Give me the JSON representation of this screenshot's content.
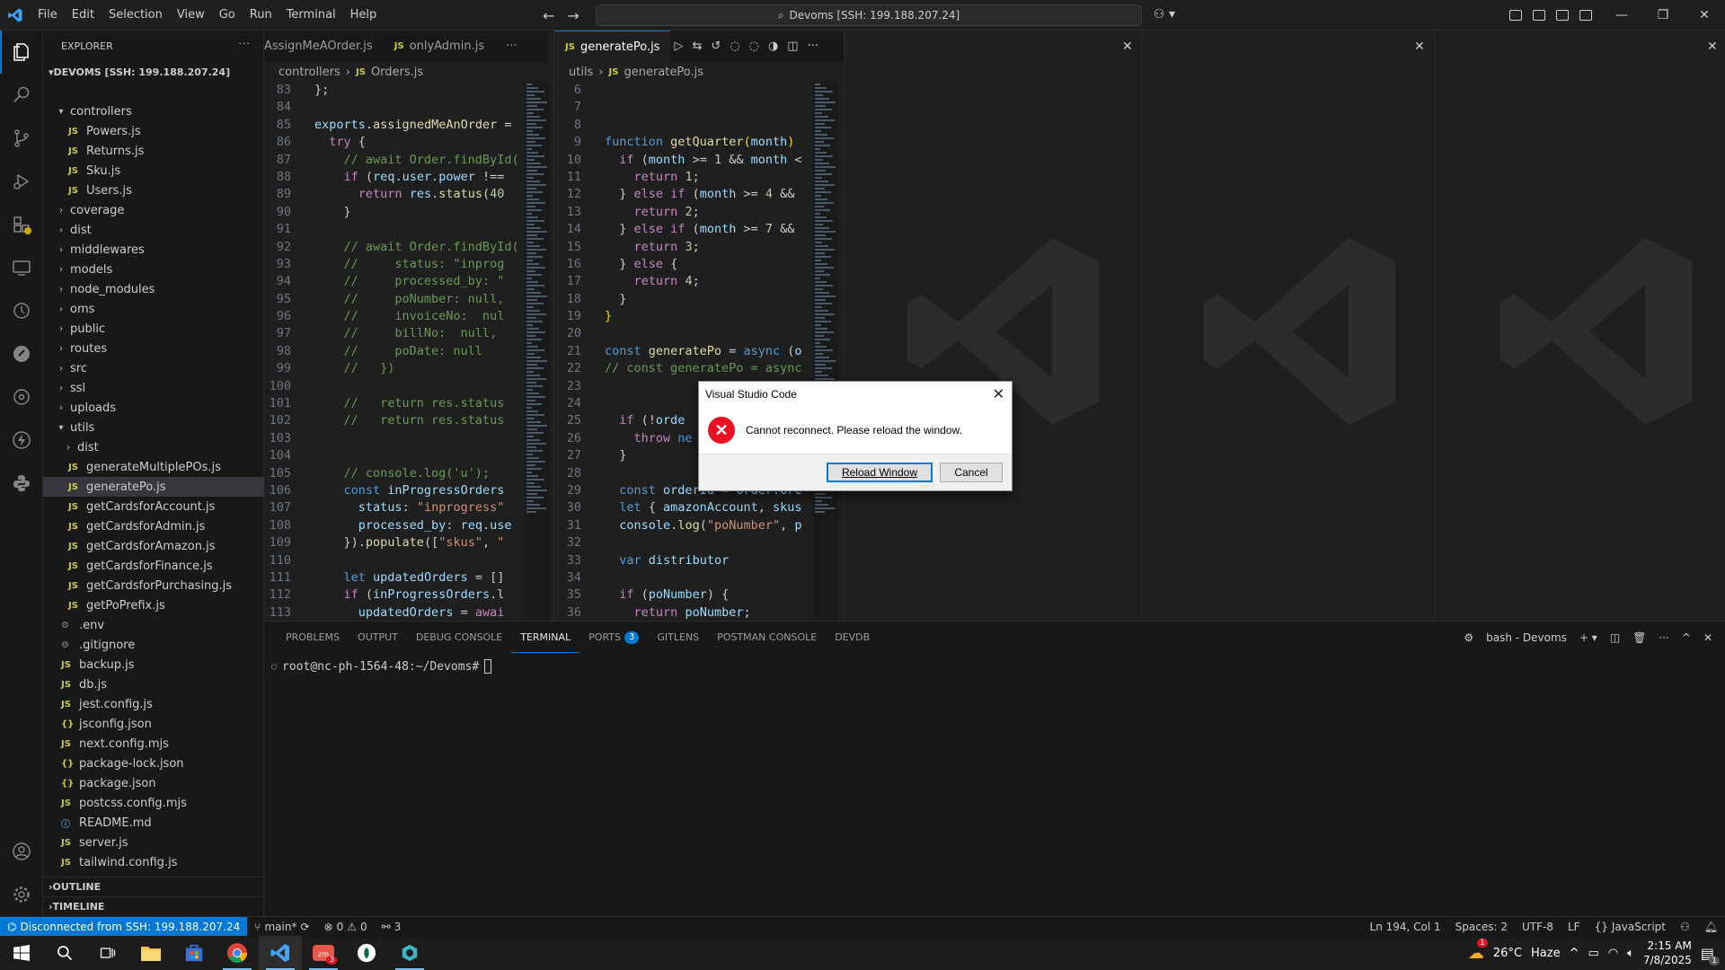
{
  "titlebar": {
    "menu": [
      "File",
      "Edit",
      "Selection",
      "View",
      "Go",
      "Run",
      "Terminal",
      "Help"
    ],
    "search": "Devoms [SSH: 199.188.207.24]"
  },
  "explorer": {
    "header": "EXPLORER",
    "root": "DEVOMS [SSH: 199.188.207.24]",
    "tree": [
      {
        "label": "controllers",
        "type": "folder-open",
        "depth": 1
      },
      {
        "label": "Powers.js",
        "type": "js",
        "depth": 2
      },
      {
        "label": "Returns.js",
        "type": "js",
        "depth": 2
      },
      {
        "label": "Sku.js",
        "type": "js",
        "depth": 2
      },
      {
        "label": "Users.js",
        "type": "js",
        "depth": 2
      },
      {
        "label": "coverage",
        "type": "folder",
        "depth": 1
      },
      {
        "label": "dist",
        "type": "folder",
        "depth": 1
      },
      {
        "label": "middlewares",
        "type": "folder",
        "depth": 1
      },
      {
        "label": "models",
        "type": "folder",
        "depth": 1
      },
      {
        "label": "node_modules",
        "type": "folder",
        "depth": 1
      },
      {
        "label": "oms",
        "type": "folder",
        "depth": 1
      },
      {
        "label": "public",
        "type": "folder",
        "depth": 1
      },
      {
        "label": "routes",
        "type": "folder",
        "depth": 1
      },
      {
        "label": "src",
        "type": "folder",
        "depth": 1
      },
      {
        "label": "ssl",
        "type": "folder",
        "depth": 1
      },
      {
        "label": "uploads",
        "type": "folder",
        "depth": 1
      },
      {
        "label": "utils",
        "type": "folder-open",
        "depth": 1
      },
      {
        "label": "dist",
        "type": "folder",
        "depth": 2
      },
      {
        "label": "generateMultiplePOs.js",
        "type": "js",
        "depth": 2
      },
      {
        "label": "generatePo.js",
        "type": "js",
        "depth": 2,
        "selected": true
      },
      {
        "label": "getCardsforAccount.js",
        "type": "js",
        "depth": 2
      },
      {
        "label": "getCardsforAdmin.js",
        "type": "js",
        "depth": 2
      },
      {
        "label": "getCardsforAmazon.js",
        "type": "js",
        "depth": 2
      },
      {
        "label": "getCardsforFinance.js",
        "type": "js",
        "depth": 2
      },
      {
        "label": "getCardsforPurchasing.js",
        "type": "js",
        "depth": 2
      },
      {
        "label": "getPoPrefix.js",
        "type": "js",
        "depth": 2
      },
      {
        "label": ".env",
        "type": "env",
        "depth": 1
      },
      {
        "label": ".gitignore",
        "type": "env",
        "depth": 1
      },
      {
        "label": "backup.js",
        "type": "js",
        "depth": 1
      },
      {
        "label": "db.js",
        "type": "js",
        "depth": 1
      },
      {
        "label": "jest.config.js",
        "type": "js",
        "depth": 1
      },
      {
        "label": "jsconfig.json",
        "type": "json",
        "depth": 1
      },
      {
        "label": "next.config.mjs",
        "type": "js",
        "depth": 1
      },
      {
        "label": "package-lock.json",
        "type": "json",
        "depth": 1
      },
      {
        "label": "package.json",
        "type": "json",
        "depth": 1
      },
      {
        "label": "postcss.config.mjs",
        "type": "js",
        "depth": 1
      },
      {
        "label": "README.md",
        "type": "info",
        "depth": 1
      },
      {
        "label": "server.js",
        "type": "js",
        "depth": 1
      },
      {
        "label": "tailwind.config.js",
        "type": "js",
        "depth": 1
      }
    ],
    "outline": "OUTLINE",
    "timeline": "TIMELINE"
  },
  "editor1": {
    "tabs": [
      {
        "label": "AssignMeAOrder.js",
        "active": false
      },
      {
        "label": "onlyAdmin.js",
        "active": false
      }
    ],
    "breadcrumb": [
      "controllers",
      "Orders.js"
    ],
    "lines": [
      {
        "n": "83",
        "html": "<span class='src'>};</span>"
      },
      {
        "n": "84",
        "html": ""
      },
      {
        "n": "85",
        "html": "<span class='v'>exports</span><span class='src'>.</span><span class='f'>assignedMeAnOrder</span><span class='src'> = </span>"
      },
      {
        "n": "86",
        "html": "<span class='src'>  </span><span class='kc'>try</span><span class='src'> {</span>"
      },
      {
        "n": "87",
        "html": "<span class='c'>    // await Order.findById(</span>"
      },
      {
        "n": "88",
        "html": "<span class='src'>    </span><span class='kc'>if</span><span class='src'> (</span><span class='v'>req</span><span class='src'>.</span><span class='v'>user</span><span class='src'>.</span><span class='v'>power</span><span class='src'> !==</span>"
      },
      {
        "n": "89",
        "html": "<span class='src'>      </span><span class='kc'>return</span><span class='src'> </span><span class='v'>res</span><span class='src'>.</span><span class='f'>status</span><span class='src'>(</span><span class='n'>40</span>"
      },
      {
        "n": "90",
        "html": "<span class='src'>    }</span>"
      },
      {
        "n": "91",
        "html": ""
      },
      {
        "n": "92",
        "html": "<span class='c'>    // await Order.findById(</span>"
      },
      {
        "n": "93",
        "html": "<span class='c'>    //     status: \"inprog</span>"
      },
      {
        "n": "94",
        "html": "<span class='c'>    //     processed_by: \"</span>"
      },
      {
        "n": "95",
        "html": "<span class='c'>    //     poNumber: null,</span>"
      },
      {
        "n": "96",
        "html": "<span class='c'>    //     invoiceNo:  nul</span>"
      },
      {
        "n": "97",
        "html": "<span class='c'>    //     billNo:  null,</span>"
      },
      {
        "n": "98",
        "html": "<span class='c'>    //     poDate: null</span>"
      },
      {
        "n": "99",
        "html": "<span class='c'>    //   })</span>"
      },
      {
        "n": "100",
        "html": ""
      },
      {
        "n": "101",
        "html": "<span class='c'>    //   return res.status</span>"
      },
      {
        "n": "102",
        "html": "<span class='c'>    //   return res.status</span>"
      },
      {
        "n": "103",
        "html": ""
      },
      {
        "n": "104",
        "html": ""
      },
      {
        "n": "105",
        "html": "<span class='c'>    // console.log('u');</span>"
      },
      {
        "n": "106",
        "html": "<span class='src'>    </span><span class='k'>const</span><span class='src'> </span><span class='v'>inProgressOrders</span>"
      },
      {
        "n": "107",
        "html": "<span class='src'>      </span><span class='v'>status</span><span class='src'>: </span><span class='s'>\"inprogress\"</span>"
      },
      {
        "n": "108",
        "html": "<span class='src'>      </span><span class='v'>processed_by</span><span class='src'>: </span><span class='v'>req</span><span class='src'>.</span><span class='v'>use</span>"
      },
      {
        "n": "109",
        "html": "<span class='src'>    }).</span><span class='f'>populate</span><span class='src'>([</span><span class='s'>\"skus\"</span><span class='src'>, </span><span class='s'>\"</span>"
      },
      {
        "n": "110",
        "html": ""
      },
      {
        "n": "111",
        "html": "<span class='src'>    </span><span class='k'>let</span><span class='src'> </span><span class='v'>updatedOrders</span><span class='src'> = []</span>"
      },
      {
        "n": "112",
        "html": "<span class='src'>    </span><span class='kc'>if</span><span class='src'> (</span><span class='v'>inProgressOrders</span><span class='src'>.l</span>"
      },
      {
        "n": "113",
        "html": "<span class='src'>      </span><span class='v'>updatedOrders</span><span class='src'> = </span><span class='kc'>awai</span>"
      },
      {
        "n": "114",
        "html": "<span class='src'>        </span><span class='v'>inProgressOrders</span><span class='src'>.m</span>"
      }
    ]
  },
  "editor2": {
    "tabs": [
      {
        "label": "generatePo.js",
        "active": true
      }
    ],
    "breadcrumb": [
      "utils",
      "generatePo.js"
    ],
    "lines": [
      {
        "n": "6",
        "html": ""
      },
      {
        "n": "7",
        "html": ""
      },
      {
        "n": "8",
        "html": ""
      },
      {
        "n": "9",
        "html": "<span class='k'>function</span><span class='src'> </span><span class='f'>getQuarter</span><span class='b'>(</span><span class='v'>month</span><span class='b'>)</span>"
      },
      {
        "n": "10",
        "html": "<span class='src'>  </span><span class='kc'>if</span><span class='src'> (</span><span class='v'>month</span><span class='src'> >= </span><span class='n'>1</span><span class='src'> && </span><span class='v'>month</span><span class='src'> <</span>"
      },
      {
        "n": "11",
        "html": "<span class='src'>    </span><span class='kc'>return</span><span class='src'> </span><span class='n'>1</span><span class='src'>;</span>"
      },
      {
        "n": "12",
        "html": "<span class='src'>  } </span><span class='kc'>else if</span><span class='src'> (</span><span class='v'>month</span><span class='src'> >= </span><span class='n'>4</span><span class='src'> &&</span>"
      },
      {
        "n": "13",
        "html": "<span class='src'>    </span><span class='kc'>return</span><span class='src'> </span><span class='n'>2</span><span class='src'>;</span>"
      },
      {
        "n": "14",
        "html": "<span class='src'>  } </span><span class='kc'>else if</span><span class='src'> (</span><span class='v'>month</span><span class='src'> >= </span><span class='n'>7</span><span class='src'> &&</span>"
      },
      {
        "n": "15",
        "html": "<span class='src'>    </span><span class='kc'>return</span><span class='src'> </span><span class='n'>3</span><span class='src'>;</span>"
      },
      {
        "n": "16",
        "html": "<span class='src'>  } </span><span class='kc'>else</span><span class='src'> {</span>"
      },
      {
        "n": "17",
        "html": "<span class='src'>    </span><span class='kc'>return</span><span class='src'> </span><span class='n'>4</span><span class='src'>;</span>"
      },
      {
        "n": "18",
        "html": "<span class='src'>  }</span>"
      },
      {
        "n": "19",
        "html": "<span class='b'>}</span>"
      },
      {
        "n": "20",
        "html": ""
      },
      {
        "n": "21",
        "html": "<span class='k'>const</span><span class='src'> </span><span class='f'>generatePo</span><span class='src'> = </span><span class='k'>async</span><span class='src'> (</span><span class='v'>o</span>"
      },
      {
        "n": "22",
        "html": "<span class='c'>// const generatePo = async</span>"
      },
      {
        "n": "23",
        "html": ""
      },
      {
        "n": "24",
        "html": ""
      },
      {
        "n": "25",
        "html": "<span class='src'>  </span><span class='kc'>if</span><span class='src'> (!</span><span class='v'>orde</span>"
      },
      {
        "n": "26",
        "html": "<span class='src'>    </span><span class='kc'>throw</span><span class='src'> </span><span class='k'>ne</span>"
      },
      {
        "n": "27",
        "html": "<span class='src'>  }</span>"
      },
      {
        "n": "28",
        "html": ""
      },
      {
        "n": "29",
        "html": "<span class='src'>  </span><span class='k'>const</span><span class='src'> </span><span class='v'>orderId</span><span class='src'> = </span><span class='v'>order</span><span class='src'>.</span><span class='v'>orc</span>"
      },
      {
        "n": "30",
        "html": "<span class='src'>  </span><span class='k'>let</span><span class='src'> { </span><span class='v'>amazonAccount</span><span class='src'>, </span><span class='v'>skus</span>"
      },
      {
        "n": "31",
        "html": "<span class='src'>  </span><span class='v'>console</span><span class='src'>.</span><span class='f'>log</span><span class='src'>(</span><span class='s'>\"poNumber\"</span><span class='src'>, </span><span class='v'>p</span>"
      },
      {
        "n": "32",
        "html": ""
      },
      {
        "n": "33",
        "html": "<span class='src'>  </span><span class='k'>var</span><span class='src'> </span><span class='v'>distributor</span>"
      },
      {
        "n": "34",
        "html": ""
      },
      {
        "n": "35",
        "html": "<span class='src'>  </span><span class='kc'>if</span><span class='src'> (</span><span class='v'>poNumber</span><span class='src'>) {</span>"
      },
      {
        "n": "36",
        "html": "<span class='src'>    </span><span class='kc'>return</span><span class='src'> </span><span class='v'>poNumber</span><span class='src'>;</span>"
      }
    ]
  },
  "panel": {
    "tabs": [
      {
        "label": "PROBLEMS",
        "active": false
      },
      {
        "label": "OUTPUT",
        "active": false
      },
      {
        "label": "DEBUG CONSOLE",
        "active": false
      },
      {
        "label": "TERMINAL",
        "active": true
      },
      {
        "label": "PORTS",
        "active": false,
        "badge": "3"
      },
      {
        "label": "GITLENS",
        "active": false
      },
      {
        "label": "POSTMAN CONSOLE",
        "active": false
      },
      {
        "label": "DEVDB",
        "active": false
      }
    ],
    "terminal_name": "bash - Devoms",
    "prompt": "root@nc-ph-1564-48:~/Devoms#"
  },
  "statusbar": {
    "remote": "Disconnected from SSH: 199.188.207.24",
    "branch": "main*",
    "errors": "0",
    "warnings": "0",
    "ports": "3",
    "position": "Ln 194, Col 1",
    "spaces": "Spaces: 2",
    "encoding": "UTF-8",
    "eol": "LF",
    "language": "JavaScript"
  },
  "dialog": {
    "title": "Visual Studio Code",
    "message": "Cannot reconnect. Please reload the window.",
    "primary": "Reload Window",
    "secondary": "Cancel"
  },
  "taskbar": {
    "weather_temp": "26°C",
    "weather_text": "Haze",
    "weather_badge": "1",
    "zoom_badge": "3",
    "time": "2:15 AM",
    "date": "7/8/2025",
    "notif_badge": "1"
  },
  "colors": {
    "accent": "#0078d4",
    "remote_bg": "#0078d4",
    "error": "#e81123"
  }
}
